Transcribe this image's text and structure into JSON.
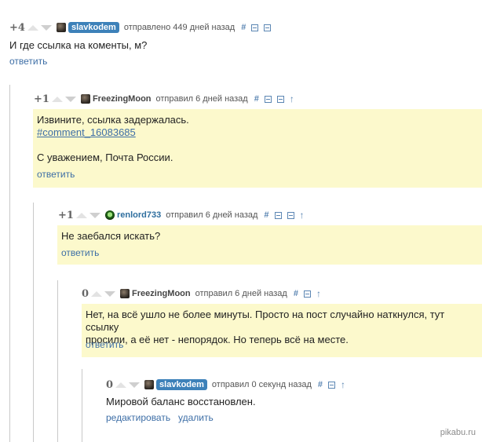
{
  "comments": [
    {
      "rating": "+4",
      "username": "slavkodem",
      "action_text": "отправлено 449 дней назад",
      "icons": [
        "hash-icon",
        "collapse-icon",
        "save-icon"
      ],
      "lines": [
        "И где ссылка на коменты, м?"
      ],
      "actions": [
        "ответить"
      ]
    },
    {
      "rating": "+1",
      "username": "FreezingMoon",
      "action_text": "отправил 6 дней назад",
      "icons": [
        "hash-icon",
        "collapse-icon",
        "save-icon",
        "arrow-up-icon"
      ],
      "lines": [
        "Извините, ссылка задержалась.",
        "#comment_16083685",
        "",
        "С уважением, Почта России."
      ],
      "actions": [
        "ответить"
      ]
    },
    {
      "rating": "+1",
      "username": "renlord733",
      "action_text": "отправил 6 дней назад",
      "icons": [
        "hash-icon",
        "collapse-icon",
        "save-icon",
        "arrow-up-icon"
      ],
      "lines": [
        "Не заебался искать?"
      ],
      "actions": [
        "ответить"
      ]
    },
    {
      "rating": "0",
      "username": "FreezingMoon",
      "action_text": "отправил 6 дней назад",
      "icons": [
        "hash-icon",
        "save-icon",
        "arrow-up-icon"
      ],
      "lines": [
        "Нет, на всё ушло не более минуты. Просто на пост случайно наткнулся, тут ссылку",
        "просили, а её нет - непорядок. Но теперь всё на месте."
      ],
      "actions": [
        "ответить"
      ]
    },
    {
      "rating": "0",
      "username": "slavkodem",
      "action_text": "отправил 0 секунд назад",
      "icons": [
        "hash-icon",
        "save-icon",
        "arrow-up-icon"
      ],
      "lines": [
        "Мировой баланс восстановлен."
      ],
      "actions": [
        "редактировать",
        "удалить"
      ]
    }
  ],
  "icon_glyphs": {
    "hash": "#",
    "arrow_up": "↑"
  },
  "watermark": "pikabu.ru",
  "colors": {
    "highlight_bg": "#fcf9cc",
    "link": "#3d6ea6",
    "username_badge": "#3d81b9"
  }
}
